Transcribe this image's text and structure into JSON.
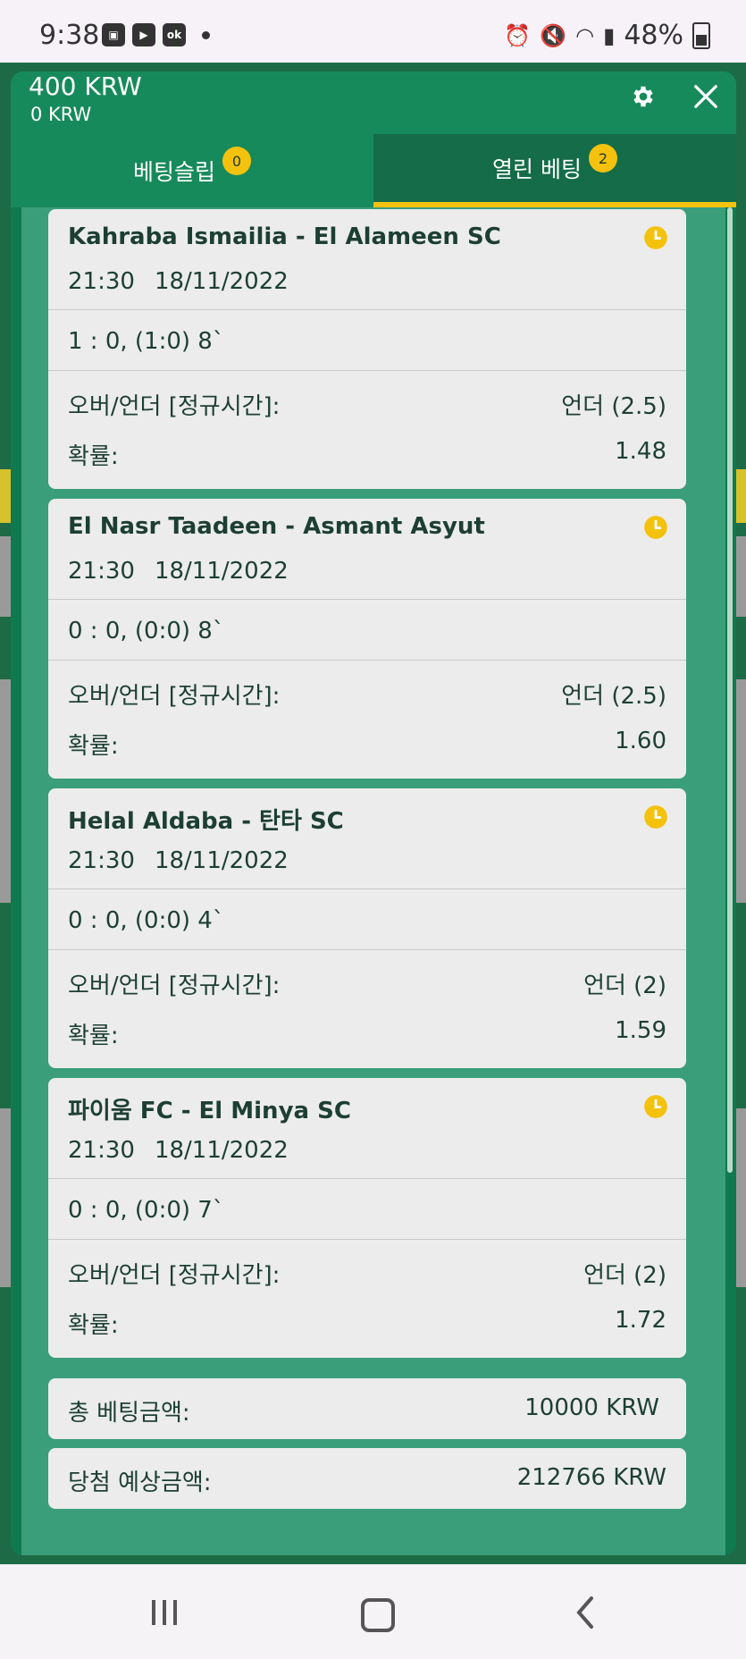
{
  "status_bar": {
    "time": "9:38",
    "battery": "48%",
    "left_icons": [
      "gallery-icon",
      "youtube-icon",
      "ok-icon"
    ],
    "right_icons": [
      "alarm-icon",
      "mute-icon",
      "wifi-icon",
      "signal-icon",
      "battery-icon"
    ]
  },
  "header": {
    "balance": "400 KRW",
    "sub_balance": "0 KRW"
  },
  "tabs": [
    {
      "label": "베팅슬립",
      "badge": "0"
    },
    {
      "label": "열린 베팅",
      "badge": "2"
    }
  ],
  "bets": [
    {
      "match": "Kahraba Ismailia - El Alameen SC",
      "time": "21:30",
      "date": "18/11/2022",
      "score": "1 : 0, (1:0) 8`",
      "market_label": "오버/언더 [정규시간]:",
      "market_value": "언더 (2.5)",
      "odds_label": "확률:",
      "odds_value": "1.48"
    },
    {
      "match": "El Nasr Taadeen - Asmant Asyut",
      "time": "21:30",
      "date": "18/11/2022",
      "score": "0 : 0, (0:0) 8`",
      "market_label": "오버/언더 [정규시간]:",
      "market_value": "언더 (2.5)",
      "odds_label": "확률:",
      "odds_value": "1.60"
    },
    {
      "match": "Helal Aldaba - 탄타 SC",
      "time": "21:30",
      "date": "18/11/2022",
      "score": "0 : 0, (0:0) 4`",
      "market_label": "오버/언더 [정규시간]:",
      "market_value": "언더 (2)",
      "odds_label": "확률:",
      "odds_value": "1.59"
    },
    {
      "match": "파이움 FC - El Minya SC",
      "time": "21:30",
      "date": "18/11/2022",
      "score": "0 : 0, (0:0) 7`",
      "market_label": "오버/언더 [정규시간]:",
      "market_value": "언더 (2)",
      "odds_label": "확률:",
      "odds_value": "1.72"
    }
  ],
  "summary": {
    "total_label": "총 베팅금액:",
    "total_value": "10000 KRW",
    "payout_label": "당첨 예상금액:",
    "payout_value": "212766 KRW"
  },
  "colors": {
    "primary_green": "#178a5b",
    "dark_green": "#146c49",
    "content_green": "#3a9e7a",
    "accent_yellow": "#f4c20d",
    "card_bg": "#ececec",
    "text_dark": "#1d3f33"
  }
}
